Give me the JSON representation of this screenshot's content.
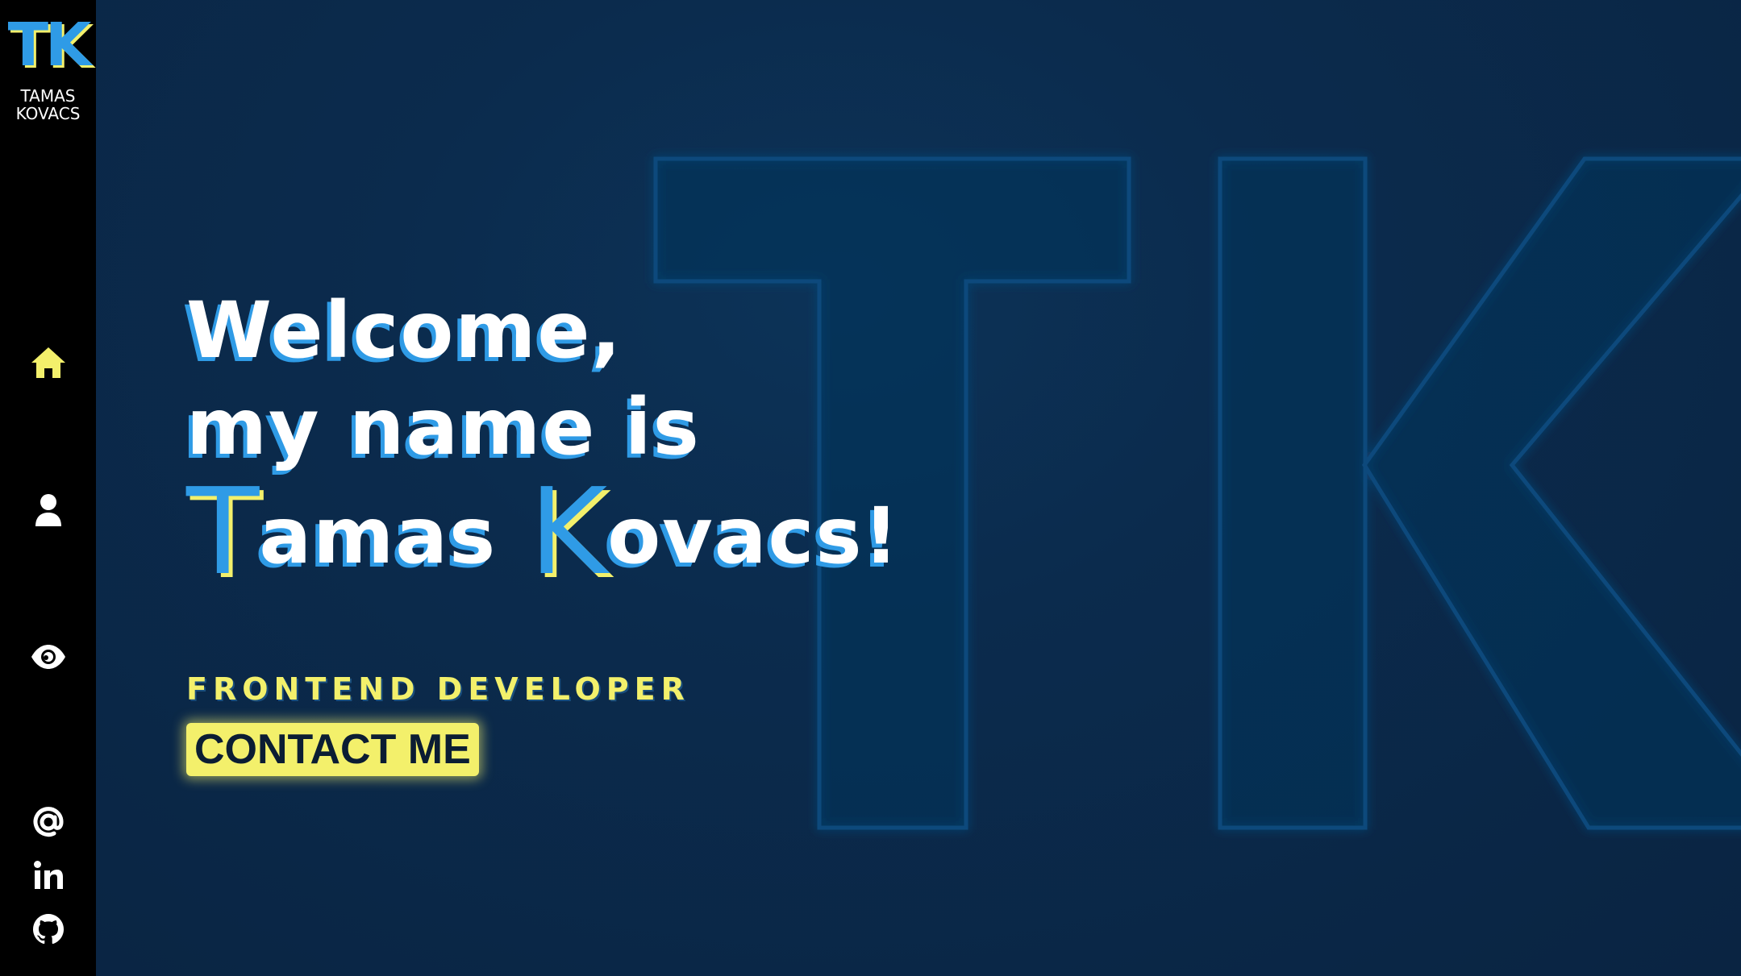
{
  "brand": {
    "mark": "TK",
    "name": "TAMAS KOVACS"
  },
  "nav": [
    {
      "icon": "home-icon",
      "active": true
    },
    {
      "icon": "user-icon",
      "active": false
    },
    {
      "icon": "eye-icon",
      "active": false
    }
  ],
  "social": [
    {
      "icon": "at-icon"
    },
    {
      "icon": "linkedin-icon"
    },
    {
      "icon": "github-icon"
    }
  ],
  "hero": {
    "line1": "Welcome,",
    "line2": "my name is",
    "first_initial": "T",
    "first_rest": "amas",
    "last_initial": "K",
    "last_rest": "ovacs!",
    "role": "FRONTEND DEVELOPER",
    "cta": "CONTACT ME",
    "background_mark": "TK"
  },
  "colors": {
    "background": "#0b2644",
    "sidebar": "#000000",
    "accent_yellow": "#f3f06b",
    "accent_blue": "#2f9be6",
    "outline": "#1a4f7e"
  }
}
